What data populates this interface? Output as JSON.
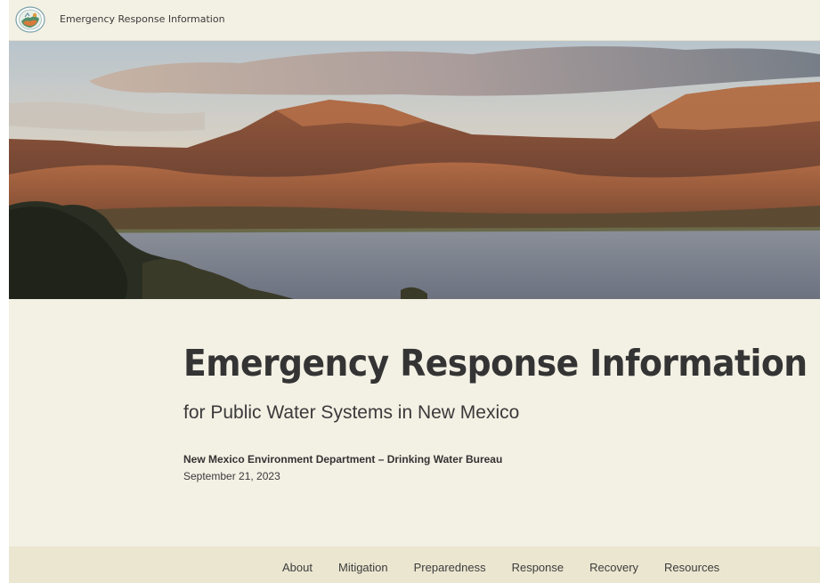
{
  "header": {
    "site_title": "Emergency Response Information",
    "logo_icon": "nmed-logo-icon"
  },
  "hero": {
    "image": "mountain-lake-landscape"
  },
  "main": {
    "headline": "Emergency Response Information",
    "subheadline": "for Public Water Systems in New Mexico",
    "organization": "New Mexico Environment Department – Drinking Water Bureau",
    "date": "September 21, 2023"
  },
  "nav": {
    "items": [
      {
        "label": "About"
      },
      {
        "label": "Mitigation"
      },
      {
        "label": "Preparedness"
      },
      {
        "label": "Response"
      },
      {
        "label": "Recovery"
      },
      {
        "label": "Resources"
      }
    ]
  },
  "colors": {
    "background": "#f3f0e4",
    "nav_background": "#ebe6d0",
    "text": "#343434"
  }
}
